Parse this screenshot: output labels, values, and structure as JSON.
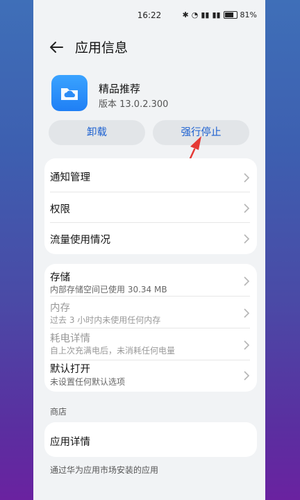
{
  "status": {
    "time": "16:22",
    "battery": "81%"
  },
  "header": {
    "title": "应用信息"
  },
  "app": {
    "name": "精品推荐",
    "version": "版本 13.0.2.300"
  },
  "buttons": {
    "uninstall": "卸载",
    "force_stop": "强行停止"
  },
  "section1": {
    "items": [
      {
        "label": "通知管理"
      },
      {
        "label": "权限"
      },
      {
        "label": "流量使用情况"
      }
    ]
  },
  "section2": {
    "items": [
      {
        "label": "存储",
        "sub": "内部存储空间已使用 30.34 MB"
      },
      {
        "label": "内存",
        "sub": "过去 3 小时内未使用任何内存"
      },
      {
        "label": "耗电详情",
        "sub": "自上次充满电后，未消耗任何电量"
      },
      {
        "label": "默认打开",
        "sub": "未设置任何默认选项"
      }
    ]
  },
  "store": {
    "section_label": "商店",
    "details_label": "应用详情",
    "footer": "通过华为应用市场安装的应用"
  }
}
